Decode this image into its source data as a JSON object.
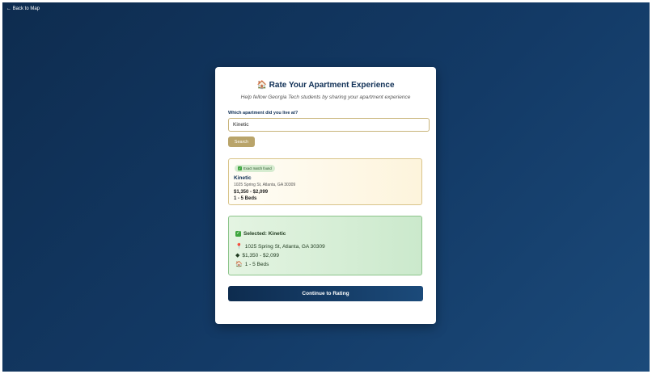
{
  "nav": {
    "back_label": "← Back to Map"
  },
  "header": {
    "title_icon": "🏠",
    "title": "Rate Your Apartment Experience",
    "subtitle": "Help fellow Georgia Tech students by sharing your apartment experience"
  },
  "search": {
    "label": "Which apartment did you live at?",
    "value": "Kinetic",
    "placeholder": "",
    "button_label": "Search"
  },
  "result": {
    "badge": "Exact match found",
    "name": "Kinetic",
    "address": "1025 Spring St, Atlanta, GA 30309",
    "price": "$1,350 - $2,099",
    "beds": "1 - 5 Beds"
  },
  "selected": {
    "title": "Selected: Kinetic",
    "address": "1025 Spring St, Atlanta, GA 30309",
    "price": "$1,350 - $2,099",
    "beds": "1 - 5 Beds"
  },
  "continue_label": "Continue to Rating",
  "colors": {
    "brand_navy": "#0f2f55",
    "gold": "#b9a46a",
    "success_green": "#3fa63f"
  }
}
